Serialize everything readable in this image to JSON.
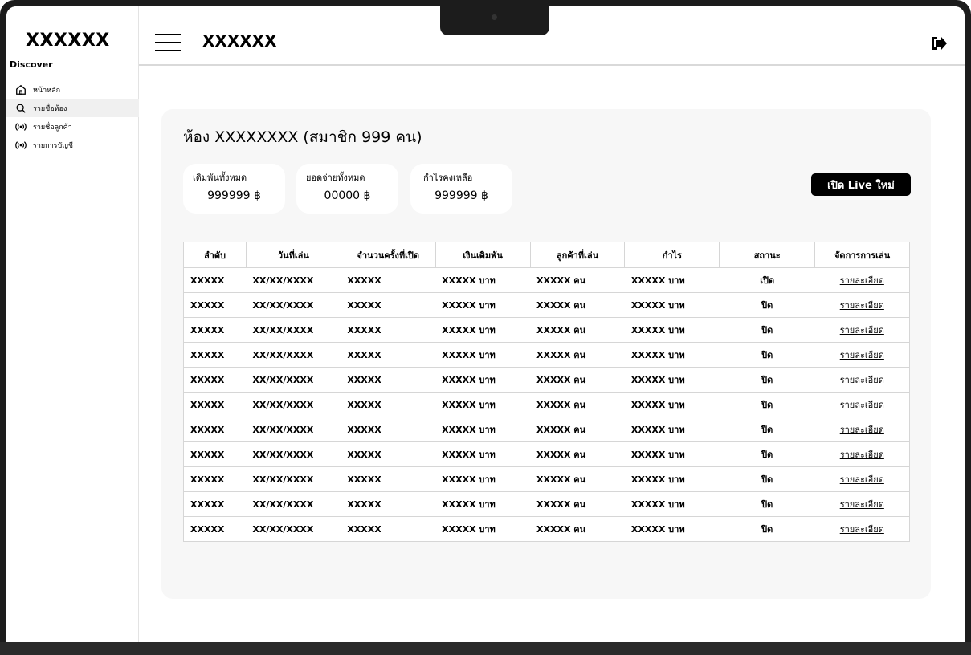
{
  "sidebar": {
    "brand": "XXXXXX",
    "section_label": "Discover",
    "items": [
      {
        "label": "หน้าหลัก",
        "icon": "home-icon"
      },
      {
        "label": "รายชื่อห้อง",
        "icon": "search-icon"
      },
      {
        "label": "รายชื่อลูกค้า",
        "icon": "broadcast-icon"
      },
      {
        "label": "รายการบัญชี",
        "icon": "broadcast-icon"
      }
    ]
  },
  "header": {
    "title": "XXXXXX",
    "logout_icon": "logout-icon"
  },
  "room": {
    "title": "ห้อง XXXXXXXX  (สมาชิก 999 คน)",
    "stats": [
      {
        "label": "เดิมพันทั้งหมด",
        "value": "999999 ฿"
      },
      {
        "label": "ยอดจ่ายทั้งหมด",
        "value": "00000 ฿"
      },
      {
        "label": "กำไรคงเหลือ",
        "value": "999999 ฿"
      }
    ],
    "new_live_label": "เปิด Live ใหม่"
  },
  "table": {
    "headers": [
      "ลำดับ",
      "วันที่เล่น",
      "จำนวนครั้งที่เปิด",
      "เงินเดิมพัน",
      "ลูกค้าที่เล่น",
      "กำไร",
      "สถานะ",
      "จัดการการเล่น"
    ],
    "rows": [
      [
        "XXXXX",
        "XX/XX/XXXX",
        "XXXXX",
        "XXXXX  บาท",
        "XXXXX  คน",
        "XXXXX  บาท",
        "เปิด",
        "รายละเอียด"
      ],
      [
        "XXXXX",
        "XX/XX/XXXX",
        "XXXXX",
        "XXXXX  บาท",
        "XXXXX  คน",
        "XXXXX  บาท",
        "ปิด",
        "รายละเอียด"
      ],
      [
        "XXXXX",
        "XX/XX/XXXX",
        "XXXXX",
        "XXXXX  บาท",
        "XXXXX  คน",
        "XXXXX  บาท",
        "ปิด",
        "รายละเอียด"
      ],
      [
        "XXXXX",
        "XX/XX/XXXX",
        "XXXXX",
        "XXXXX  บาท",
        "XXXXX  คน",
        "XXXXX  บาท",
        "ปิด",
        "รายละเอียด"
      ],
      [
        "XXXXX",
        "XX/XX/XXXX",
        "XXXXX",
        "XXXXX  บาท",
        "XXXXX  คน",
        "XXXXX  บาท",
        "ปิด",
        "รายละเอียด"
      ],
      [
        "XXXXX",
        "XX/XX/XXXX",
        "XXXXX",
        "XXXXX  บาท",
        "XXXXX  คน",
        "XXXXX  บาท",
        "ปิด",
        "รายละเอียด"
      ],
      [
        "XXXXX",
        "XX/XX/XXXX",
        "XXXXX",
        "XXXXX  บาท",
        "XXXXX  คน",
        "XXXXX  บาท",
        "ปิด",
        "รายละเอียด"
      ],
      [
        "XXXXX",
        "XX/XX/XXXX",
        "XXXXX",
        "XXXXX  บาท",
        "XXXXX  คน",
        "XXXXX  บาท",
        "ปิด",
        "รายละเอียด"
      ],
      [
        "XXXXX",
        "XX/XX/XXXX",
        "XXXXX",
        "XXXXX  บาท",
        "XXXXX  คน",
        "XXXXX  บาท",
        "ปิด",
        "รายละเอียด"
      ],
      [
        "XXXXX",
        "XX/XX/XXXX",
        "XXXXX",
        "XXXXX  บาท",
        "XXXXX  คน",
        "XXXXX  บาท",
        "ปิด",
        "รายละเอียด"
      ],
      [
        "XXXXX",
        "XX/XX/XXXX",
        "XXXXX",
        "XXXXX  บาท",
        "XXXXX  คน",
        "XXXXX  บาท",
        "ปิด",
        "รายละเอียด"
      ]
    ]
  }
}
